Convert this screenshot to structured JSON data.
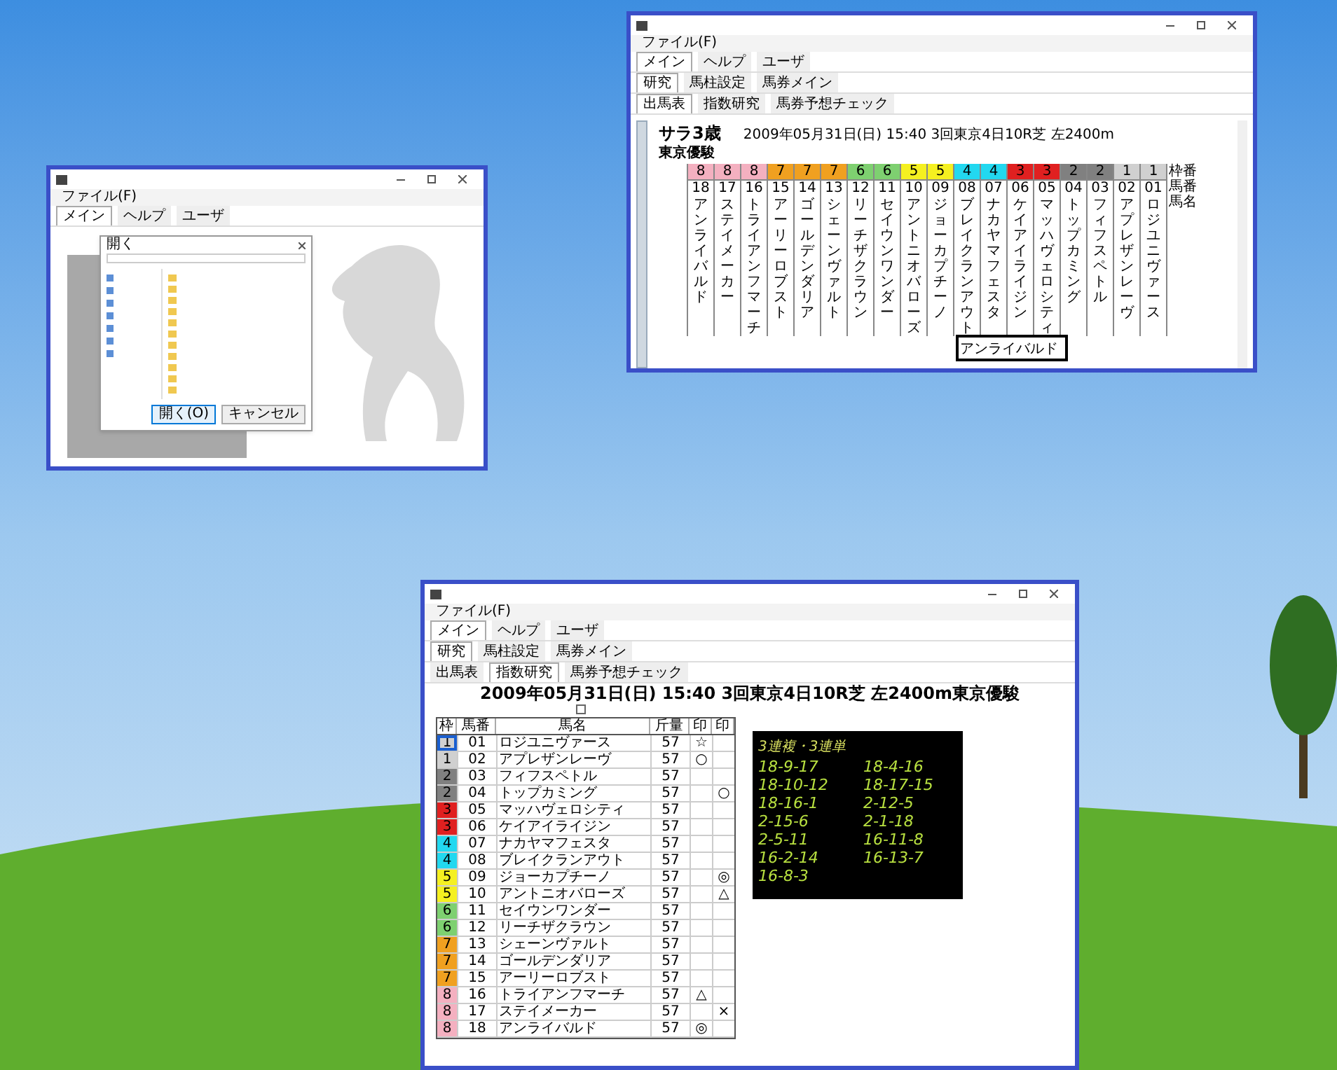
{
  "file_window": {
    "menu": [
      "ファイル(F)"
    ],
    "tabs": [
      {
        "label": "メイン",
        "selected": true
      },
      {
        "label": "ヘルプ",
        "selected": false
      },
      {
        "label": "ユーザ",
        "selected": false
      }
    ],
    "dialog": {
      "title": "開く",
      "buttons": [
        {
          "label": "開く(O)",
          "selected": true
        },
        {
          "label": "キャンセル",
          "selected": false
        }
      ]
    }
  },
  "grid_window": {
    "menu": [
      "ファイル(F)"
    ],
    "tabs": [
      {
        "label": "メイン",
        "selected": true
      },
      {
        "label": "ヘルプ",
        "selected": false
      },
      {
        "label": "ユーザ",
        "selected": false
      }
    ],
    "subtabs": [
      {
        "label": "研究",
        "selected": true
      },
      {
        "label": "馬柱設定",
        "selected": false
      },
      {
        "label": "馬券メイン",
        "selected": false
      }
    ],
    "viewtabs": [
      {
        "label": "出馬表",
        "selected": true
      },
      {
        "label": "指数研究",
        "selected": false
      },
      {
        "label": "馬券予想チェック",
        "selected": false
      }
    ],
    "race_class": "サラ3歳",
    "race_info": "2009年05月31日(日) 15:40 3回東京4日10R芝 左2400m",
    "race_name": "東京優駿",
    "row_labels": [
      "枠番",
      "馬番",
      "馬名"
    ],
    "entries": [
      {
        "frame": "8",
        "number": "18",
        "name": "アンライバルド",
        "color": "#f4b0c0"
      },
      {
        "frame": "8",
        "number": "17",
        "name": "ステイメーカー",
        "color": "#f4b0c0"
      },
      {
        "frame": "8",
        "number": "16",
        "name": "トライアンフマーチ",
        "color": "#f4b0c0"
      },
      {
        "frame": "7",
        "number": "15",
        "name": "アーリーロブスト",
        "color": "#f0a020"
      },
      {
        "frame": "7",
        "number": "14",
        "name": "ゴールデンダリア",
        "color": "#f0a020"
      },
      {
        "frame": "7",
        "number": "13",
        "name": "シェーンヴァルト",
        "color": "#f0a020"
      },
      {
        "frame": "6",
        "number": "12",
        "name": "リーチザクラウン",
        "color": "#7ed070"
      },
      {
        "frame": "6",
        "number": "11",
        "name": "セイウンワンダー",
        "color": "#7ed070"
      },
      {
        "frame": "5",
        "number": "10",
        "name": "アントニオバローズ",
        "color": "#f5f020"
      },
      {
        "frame": "5",
        "number": "09",
        "name": "ジョーカプチーノ",
        "color": "#f5f020"
      },
      {
        "frame": "4",
        "number": "08",
        "name": "ブレイクランアウト",
        "color": "#22d8f0"
      },
      {
        "frame": "4",
        "number": "07",
        "name": "ナカヤマフェスタ",
        "color": "#22d8f0"
      },
      {
        "frame": "3",
        "number": "06",
        "name": "ケイアイライジン",
        "color": "#e02020"
      },
      {
        "frame": "3",
        "number": "05",
        "name": "マッハヴェロシティ",
        "color": "#e02020"
      },
      {
        "frame": "2",
        "number": "04",
        "name": "トップカミング",
        "color": "#808080"
      },
      {
        "frame": "2",
        "number": "03",
        "name": "フィフスペトル",
        "color": "#808080"
      },
      {
        "frame": "1",
        "number": "02",
        "name": "アプレザンレーヴ",
        "color": "#d0d0d0"
      },
      {
        "frame": "1",
        "number": "01",
        "name": "ロジユニヴァース",
        "color": "#d0d0d0"
      }
    ],
    "popup": {
      "name": "アンライバルド"
    }
  },
  "table_window": {
    "menu": [
      "ファイル(F)"
    ],
    "tabs": [
      {
        "label": "メイン",
        "selected": true
      },
      {
        "label": "ヘルプ",
        "selected": false
      },
      {
        "label": "ユーザ",
        "selected": false
      }
    ],
    "subtabs": [
      {
        "label": "研究",
        "selected": true
      },
      {
        "label": "馬柱設定",
        "selected": false
      },
      {
        "label": "馬券メイン",
        "selected": false
      }
    ],
    "viewtabs": [
      {
        "label": "出馬表",
        "selected": false
      },
      {
        "label": "指数研究",
        "selected": true
      },
      {
        "label": "馬券予想チェック",
        "selected": false
      }
    ],
    "heading": "2009年05月31日(日) 15:40 3回東京4日10R芝 左2400m東京優駿",
    "checkbox": {
      "checked": false
    },
    "table": {
      "columns": [
        "枠",
        "馬番",
        "馬名",
        "斤量",
        "印",
        "印"
      ],
      "rows": [
        {
          "frame": "1",
          "number": "01",
          "name": "ロジユニヴァース",
          "weight": "57",
          "mark_1": "☆",
          "mark_2": "",
          "color": "#d0d0d0",
          "selected": true
        },
        {
          "frame": "1",
          "number": "02",
          "name": "アプレザンレーヴ",
          "weight": "57",
          "mark_1": "○",
          "mark_2": "",
          "color": "#d0d0d0",
          "selected": false
        },
        {
          "frame": "2",
          "number": "03",
          "name": "フィフスペトル",
          "weight": "57",
          "mark_1": "",
          "mark_2": "",
          "color": "#808080",
          "selected": false
        },
        {
          "frame": "2",
          "number": "04",
          "name": "トップカミング",
          "weight": "57",
          "mark_1": "",
          "mark_2": "○",
          "color": "#808080",
          "selected": false
        },
        {
          "frame": "3",
          "number": "05",
          "name": "マッハヴェロシティ",
          "weight": "57",
          "mark_1": "",
          "mark_2": "",
          "color": "#e02020",
          "selected": false
        },
        {
          "frame": "3",
          "number": "06",
          "name": "ケイアイライジン",
          "weight": "57",
          "mark_1": "",
          "mark_2": "",
          "color": "#e02020",
          "selected": false
        },
        {
          "frame": "4",
          "number": "07",
          "name": "ナカヤマフェスタ",
          "weight": "57",
          "mark_1": "",
          "mark_2": "",
          "color": "#22d8f0",
          "selected": false
        },
        {
          "frame": "4",
          "number": "08",
          "name": "ブレイクランアウト",
          "weight": "57",
          "mark_1": "",
          "mark_2": "",
          "color": "#22d8f0",
          "selected": false
        },
        {
          "frame": "5",
          "number": "09",
          "name": "ジョーカプチーノ",
          "weight": "57",
          "mark_1": "",
          "mark_2": "◎",
          "color": "#f5f020",
          "selected": false
        },
        {
          "frame": "5",
          "number": "10",
          "name": "アントニオバローズ",
          "weight": "57",
          "mark_1": "",
          "mark_2": "△",
          "color": "#f5f020",
          "selected": false
        },
        {
          "frame": "6",
          "number": "11",
          "name": "セイウンワンダー",
          "weight": "57",
          "mark_1": "",
          "mark_2": "",
          "color": "#7ed070",
          "selected": false
        },
        {
          "frame": "6",
          "number": "12",
          "name": "リーチザクラウン",
          "weight": "57",
          "mark_1": "",
          "mark_2": "",
          "color": "#7ed070",
          "selected": false
        },
        {
          "frame": "7",
          "number": "13",
          "name": "シェーンヴァルト",
          "weight": "57",
          "mark_1": "",
          "mark_2": "",
          "color": "#f0a020",
          "selected": false
        },
        {
          "frame": "7",
          "number": "14",
          "name": "ゴールデンダリア",
          "weight": "57",
          "mark_1": "",
          "mark_2": "",
          "color": "#f0a020",
          "selected": false
        },
        {
          "frame": "7",
          "number": "15",
          "name": "アーリーロブスト",
          "weight": "57",
          "mark_1": "",
          "mark_2": "",
          "color": "#f0a020",
          "selected": false
        },
        {
          "frame": "8",
          "number": "16",
          "name": "トライアンフマーチ",
          "weight": "57",
          "mark_1": "△",
          "mark_2": "",
          "color": "#f4b0c0",
          "selected": false
        },
        {
          "frame": "8",
          "number": "17",
          "name": "ステイメーカー",
          "weight": "57",
          "mark_1": "",
          "mark_2": "×",
          "color": "#f4b0c0",
          "selected": false
        },
        {
          "frame": "8",
          "number": "18",
          "name": "アンライバルド",
          "weight": "57",
          "mark_1": "◎",
          "mark_2": "",
          "color": "#f4b0c0",
          "selected": false
        }
      ]
    },
    "bets": {
      "title": "3連複・3連単",
      "combos": [
        "18-9-17",
        "18-4-16",
        "18-10-12",
        "18-17-15",
        "18-16-1",
        "2-12-5",
        "2-15-6",
        "2-1-18",
        "2-5-11",
        "16-11-8",
        "16-2-14",
        "16-13-7",
        "16-8-3"
      ]
    }
  }
}
